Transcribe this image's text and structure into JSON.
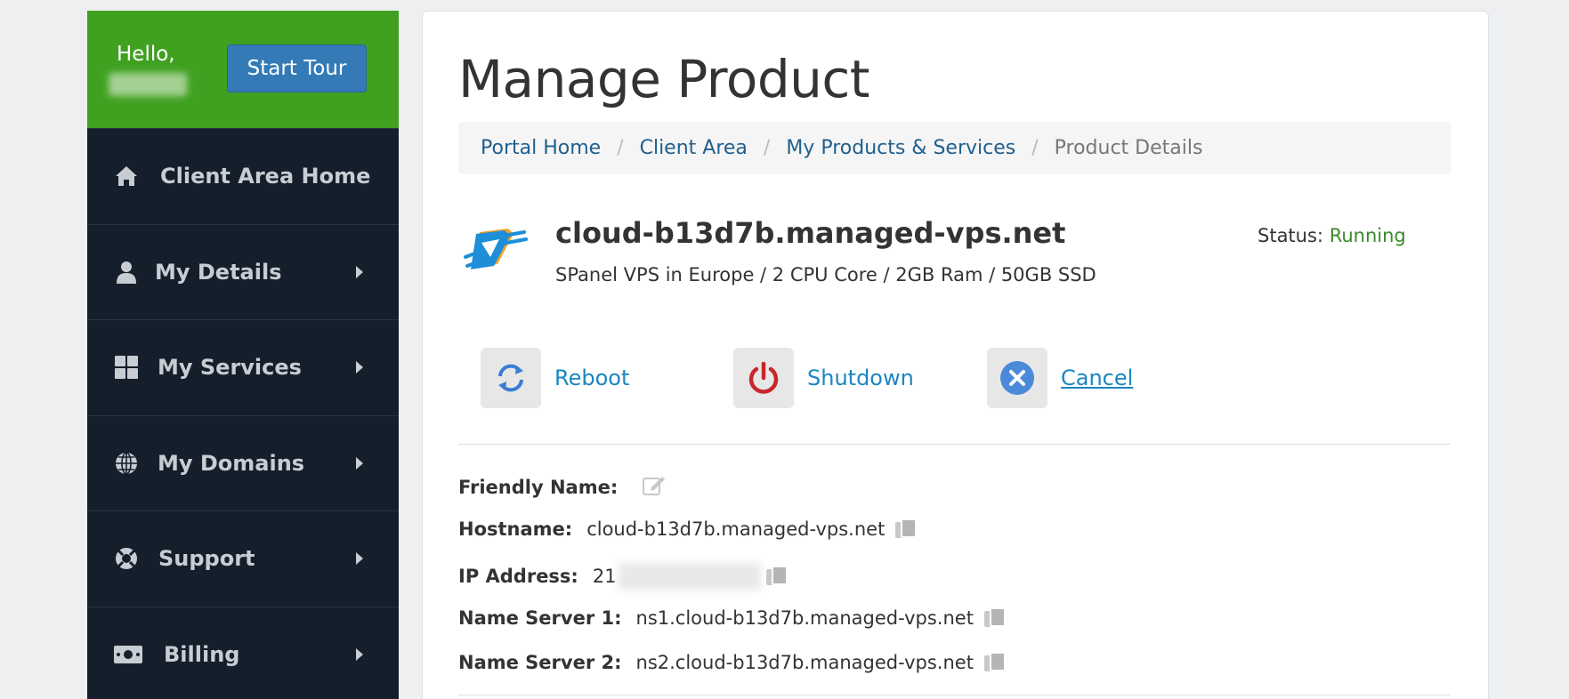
{
  "sidebar": {
    "greeting": "Hello,",
    "tour_button": "Start Tour",
    "items": [
      {
        "label": "Client Area Home",
        "icon": "home-icon",
        "has_caret": false
      },
      {
        "label": "My Details",
        "icon": "user-icon",
        "has_caret": true
      },
      {
        "label": "My Services",
        "icon": "grid-icon",
        "has_caret": true
      },
      {
        "label": "My Domains",
        "icon": "globe-icon",
        "has_caret": true
      },
      {
        "label": "Support",
        "icon": "lifebuoy-icon",
        "has_caret": true
      },
      {
        "label": "Billing",
        "icon": "money-icon",
        "has_caret": true
      }
    ]
  },
  "main": {
    "title": "Manage Product",
    "breadcrumb": [
      {
        "label": "Portal Home"
      },
      {
        "label": "Client Area"
      },
      {
        "label": "My Products & Services"
      },
      {
        "label": "Product Details"
      }
    ],
    "product": {
      "name": "cloud-b13d7b.managed-vps.net",
      "description": "SPanel VPS in Europe / 2 CPU Core / 2GB Ram / 50GB SSD",
      "status_label": "Status:",
      "status_value": "Running"
    },
    "actions": [
      {
        "label": "Reboot",
        "icon": "reboot-icon"
      },
      {
        "label": "Shutdown",
        "icon": "power-icon"
      },
      {
        "label": "Cancel",
        "icon": "cancel-icon"
      }
    ],
    "details": {
      "friendly_name_label": "Friendly Name:",
      "hostname_label": "Hostname:",
      "hostname_value": "cloud-b13d7b.managed-vps.net",
      "ip_label": "IP Address:",
      "ip_value_visible": "21",
      "ns1_label": "Name Server 1:",
      "ns1_value": "ns1.cloud-b13d7b.managed-vps.net",
      "ns2_label": "Name Server 2:",
      "ns2_value": "ns2.cloud-b13d7b.managed-vps.net"
    }
  },
  "colors": {
    "sidebar_bg": "#151e2b",
    "sidebar_header_bg": "#40a121",
    "tour_button_bg": "#337ab7",
    "link": "#1f5f8e",
    "action_link": "#1a87c0",
    "status_running": "#3a8a2a"
  }
}
